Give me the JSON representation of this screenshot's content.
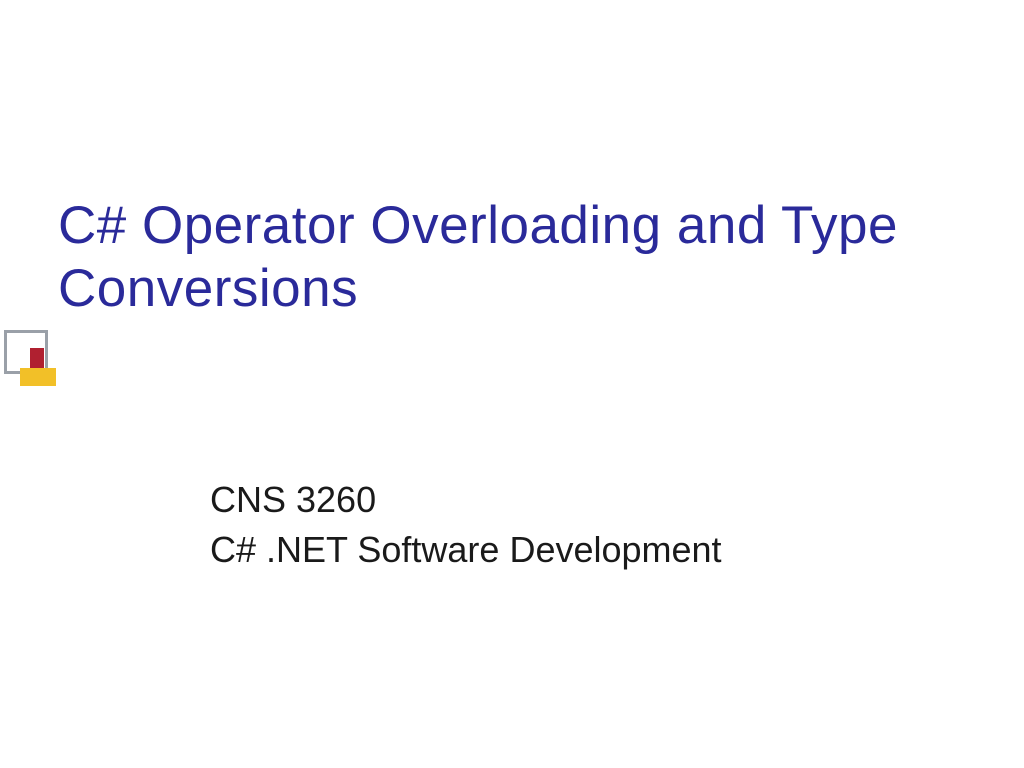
{
  "slide": {
    "title": "C# Operator Overloading and Type Conversions",
    "subtitle_line1": "CNS 3260",
    "subtitle_line2": "C# .NET Software Development"
  },
  "colors": {
    "title_color": "#2a2a9a",
    "body_color": "#1a1a1a",
    "square_outline": "#9aa0a8",
    "square_red": "#b02030",
    "square_yellow": "#f2c028"
  }
}
